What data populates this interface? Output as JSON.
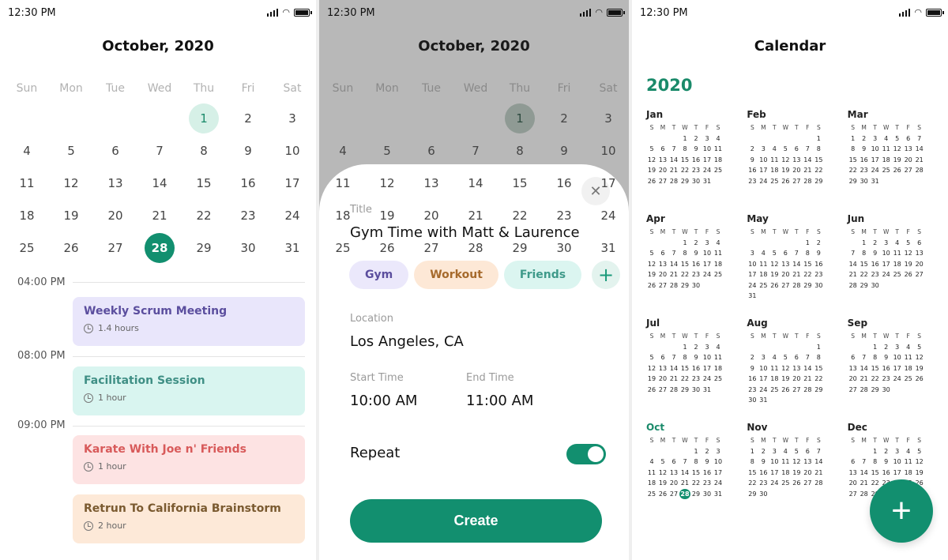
{
  "status": {
    "time": "12:30 PM"
  },
  "agenda": {
    "month_title": "October, 2020",
    "weekdays": [
      "Sun",
      "Mon",
      "Tue",
      "Wed",
      "Thu",
      "Fri",
      "Sat"
    ],
    "weeks": [
      [
        "",
        "",
        "",
        "",
        "1",
        "2",
        "3"
      ],
      [
        "4",
        "5",
        "6",
        "7",
        "8",
        "9",
        "10"
      ],
      [
        "11",
        "12",
        "13",
        "14",
        "15",
        "16",
        "17"
      ],
      [
        "18",
        "19",
        "20",
        "21",
        "22",
        "23",
        "24"
      ],
      [
        "25",
        "26",
        "27",
        "28",
        "29",
        "30",
        "31"
      ]
    ],
    "today": "1",
    "selected": "28",
    "time_labels": [
      "04:00 PM",
      "08:00 PM",
      "09:00 PM"
    ],
    "events": [
      {
        "title": "Weekly Scrum Meeting",
        "duration": "1.4 hours",
        "bg": "#e9e6fb",
        "color": "#5b4e9e"
      },
      {
        "title": "Facilitation Session",
        "duration": "1 hour",
        "bg": "#d9f5f0",
        "color": "#3f8f85"
      },
      {
        "title": "Karate With Joe n' Friends",
        "duration": "1 hour",
        "bg": "#fde3e3",
        "color": "#d85a5a"
      },
      {
        "title": "Retrun To California Brainstorm",
        "duration": "2 hour",
        "bg": "#fde9d8",
        "color": "#7a5a30"
      }
    ]
  },
  "create_sheet": {
    "month_title": "October, 2020",
    "title_label": "Title",
    "title_value": "Gym Time with Matt & Laurence",
    "tags": [
      {
        "label": "Gym",
        "bg": "#ebe8fb",
        "color": "#5b4e9e"
      },
      {
        "label": "Workout",
        "bg": "#fde8d6",
        "color": "#a66a2c"
      },
      {
        "label": "Friends",
        "bg": "#dbf5f0",
        "color": "#3f9a8a"
      }
    ],
    "add_tag_icon": "+",
    "location_label": "Location",
    "location_value": "Los Angeles, CA",
    "start_label": "Start Time",
    "start_value": "10:00 AM",
    "end_label": "End Time",
    "end_value": "11:00 AM",
    "repeat_label": "Repeat",
    "repeat_on": true,
    "create_label": "Create",
    "close_icon": "✕"
  },
  "year_view": {
    "title": "Calendar",
    "year": "2020",
    "weekday_letters": [
      "S",
      "M",
      "T",
      "W",
      "T",
      "F",
      "S"
    ],
    "months": [
      {
        "name": "Jan",
        "start": 3,
        "days": 31
      },
      {
        "name": "Feb",
        "start": 6,
        "days": 29
      },
      {
        "name": "Mar",
        "start": 0,
        "days": 31
      },
      {
        "name": "Apr",
        "start": 3,
        "days": 30
      },
      {
        "name": "May",
        "start": 5,
        "days": 31
      },
      {
        "name": "Jun",
        "start": 1,
        "days": 30
      },
      {
        "name": "Jul",
        "start": 3,
        "days": 31
      },
      {
        "name": "Aug",
        "start": 6,
        "days": 31
      },
      {
        "name": "Sep",
        "start": 2,
        "days": 30
      },
      {
        "name": "Oct",
        "start": 4,
        "days": 31,
        "current": true,
        "selected": 28
      },
      {
        "name": "Nov",
        "start": 0,
        "days": 30
      },
      {
        "name": "Dec",
        "start": 2,
        "days": 31
      }
    ],
    "fab_icon": "+"
  },
  "colors": {
    "accent": "#128f6f",
    "accent_light": "#d6f0e7"
  }
}
